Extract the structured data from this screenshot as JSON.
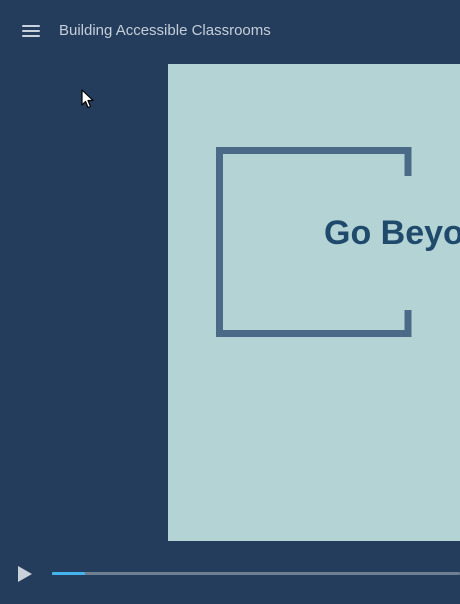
{
  "header": {
    "course_title": "Building Accessible Classrooms",
    "menu_icon": "hamburger-menu-icon"
  },
  "slide": {
    "headline": "Go Beyo"
  },
  "player": {
    "play_icon": "play-icon",
    "progress_fraction": 0.08,
    "accent_color": "#45b4ee"
  },
  "colors": {
    "background": "#253d5c",
    "slide_background": "#b4d3d5",
    "headline": "#1f4a6b",
    "bracket": "#4b6a87"
  }
}
